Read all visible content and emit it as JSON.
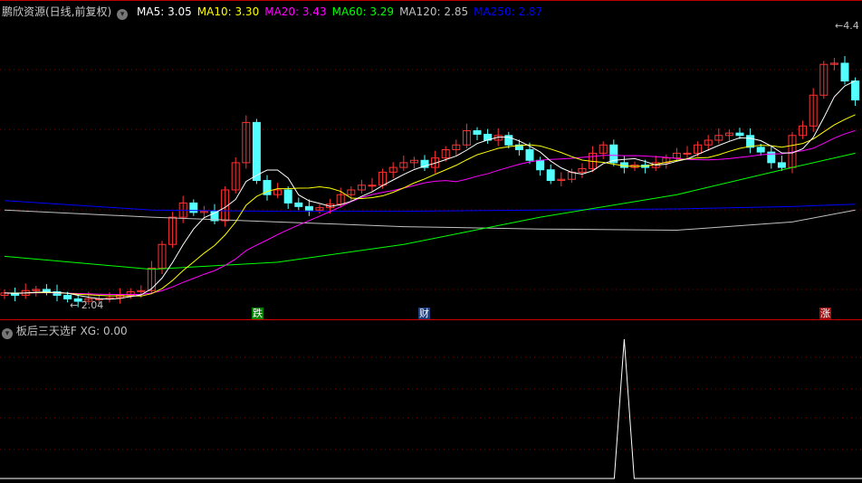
{
  "header": {
    "title": "鹏欣资源(日线,前复权)",
    "menu_icon": "chevron-down-icon",
    "ma": [
      {
        "label": "MA5: 3.05",
        "color": "#ffffff"
      },
      {
        "label": "MA10: 3.30",
        "color": "#ffff00"
      },
      {
        "label": "MA20: 3.43",
        "color": "#ff00ff"
      },
      {
        "label": "MA60: 3.29",
        "color": "#00ff00"
      },
      {
        "label": "MA120: 2.85",
        "color": "#c0c0c0"
      },
      {
        "label": "MA250: 2.87",
        "color": "#0000ff"
      }
    ]
  },
  "annotations": {
    "low": "2.04",
    "high": "4.4"
  },
  "badges": [
    {
      "text": "跌",
      "color": "#008000"
    },
    {
      "text": "财",
      "color": "#1e3c78"
    },
    {
      "text": "涨",
      "color": "#a01010"
    }
  ],
  "indicator": {
    "title": "板后三天选F",
    "value": "XG: 0.00",
    "signal_index": 59
  },
  "colors": {
    "up": "#ff3232",
    "down": "#54ffff",
    "grid": "#800000"
  },
  "price": {
    "min": 2.04,
    "max": 4.4
  },
  "closes": [
    2.14,
    2.12,
    2.16,
    2.17,
    2.15,
    2.12,
    2.09,
    2.07,
    2.09,
    2.09,
    2.1,
    2.12,
    2.15,
    2.16,
    2.35,
    2.55,
    2.78,
    2.9,
    2.82,
    2.83,
    2.75,
    3.01,
    3.24,
    3.58,
    3.09,
    2.97,
    3.01,
    2.9,
    2.87,
    2.84,
    2.86,
    2.89,
    2.97,
    3.01,
    3.05,
    3.05,
    3.16,
    3.2,
    3.24,
    3.26,
    3.2,
    3.28,
    3.35,
    3.39,
    3.51,
    3.48,
    3.43,
    3.47,
    3.39,
    3.35,
    3.26,
    3.18,
    3.09,
    3.1,
    3.16,
    3.19,
    3.32,
    3.39,
    3.24,
    3.2,
    3.22,
    3.2,
    3.24,
    3.28,
    3.32,
    3.32,
    3.39,
    3.43,
    3.47,
    3.49,
    3.47,
    3.37,
    3.33,
    3.24,
    3.2,
    3.47,
    3.55,
    3.81,
    4.07,
    4.08,
    3.93,
    3.77
  ],
  "ma_long": {
    "idx": [
      0,
      14,
      26,
      38,
      51,
      64,
      75,
      81
    ],
    "ma60": [
      2.45,
      2.34,
      2.4,
      2.55,
      2.78,
      2.97,
      3.2,
      3.32
    ],
    "ma120": [
      2.84,
      2.78,
      2.74,
      2.7,
      2.68,
      2.67,
      2.74,
      2.84
    ],
    "ma250": [
      2.92,
      2.84,
      2.83,
      2.83,
      2.84,
      2.85,
      2.87,
      2.89
    ]
  }
}
